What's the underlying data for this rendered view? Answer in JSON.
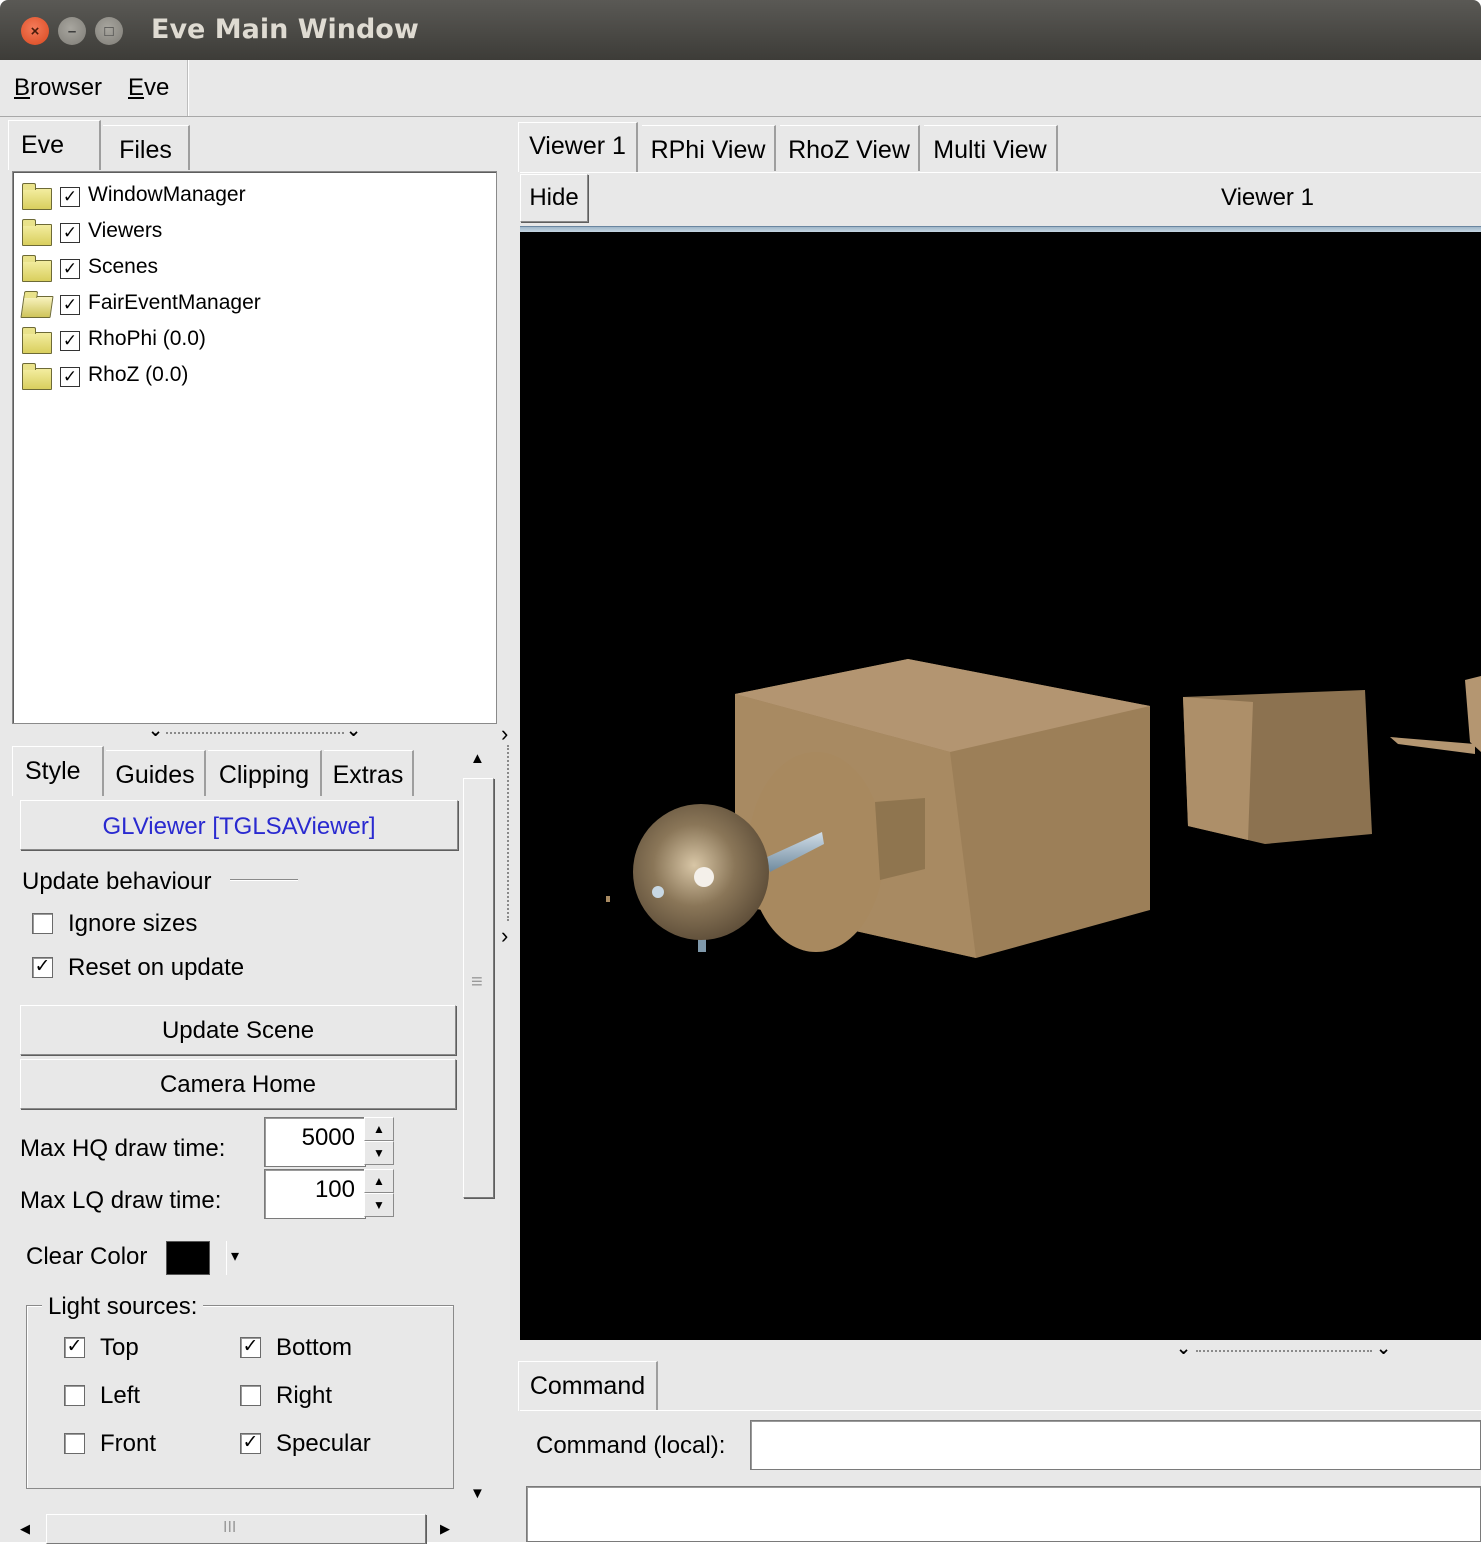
{
  "window": {
    "title": "Eve Main Window"
  },
  "menubar": {
    "items": [
      {
        "accel": "B",
        "rest": "rowser"
      },
      {
        "accel": "E",
        "rest": "ve"
      }
    ]
  },
  "left_tabs": [
    "Eve",
    "Files"
  ],
  "tree": [
    {
      "label": "WindowManager",
      "checked": true,
      "folder": "closed-folder-icon"
    },
    {
      "label": "Viewers",
      "checked": true,
      "folder": "closed-folder-icon"
    },
    {
      "label": "Scenes",
      "checked": true,
      "folder": "closed-folder-icon"
    },
    {
      "label": "FairEventManager",
      "checked": true,
      "folder": "open-folder-icon"
    },
    {
      "label": "RhoPhi (0.0)",
      "checked": true,
      "folder": "closed-folder-icon"
    },
    {
      "label": "RhoZ (0.0)",
      "checked": true,
      "folder": "closed-folder-icon"
    }
  ],
  "editor": {
    "tabs": [
      "Style",
      "Guides",
      "Clipping",
      "Extras"
    ],
    "object_button": "GLViewer [TGLSAViewer]",
    "update_behaviour": "Update behaviour",
    "ignore_sizes": {
      "label": "Ignore sizes",
      "checked": false
    },
    "reset_on_update": {
      "label": "Reset on update",
      "checked": true
    },
    "update_scene": "Update Scene",
    "camera_home": "Camera Home",
    "max_hq_label": "Max HQ draw time:",
    "max_hq_value": "5000",
    "max_lq_label": "Max LQ draw time:",
    "max_lq_value": "100",
    "clear_color_label": "Clear Color",
    "clear_color": "#000000",
    "light_sources_label": "Light sources:",
    "lights": {
      "top": {
        "label": "Top",
        "checked": true
      },
      "bottom": {
        "label": "Bottom",
        "checked": true
      },
      "left": {
        "label": "Left",
        "checked": false
      },
      "right": {
        "label": "Right",
        "checked": false
      },
      "front": {
        "label": "Front",
        "checked": false
      },
      "specular": {
        "label": "Specular",
        "checked": true
      }
    }
  },
  "viewer_tabs": [
    "Viewer 1",
    "RPhi View",
    "RhoZ View",
    "Multi View"
  ],
  "viewer": {
    "hide": "Hide",
    "title": "Viewer 1",
    "background": "#000000",
    "geometry_color": "#a88a62"
  },
  "command": {
    "tab": "Command",
    "label": "Command (local):",
    "value": ""
  },
  "glyphs": {
    "check": "✓",
    "close": "×",
    "minimize": "–",
    "maximize": "□",
    "chevron": "⌄",
    "up": "▲",
    "down": "▼",
    "left": "◀",
    "right": "▶",
    "collapse": "›",
    "grip": "≡",
    "grip_h": "III",
    "dropdown": "▾"
  }
}
